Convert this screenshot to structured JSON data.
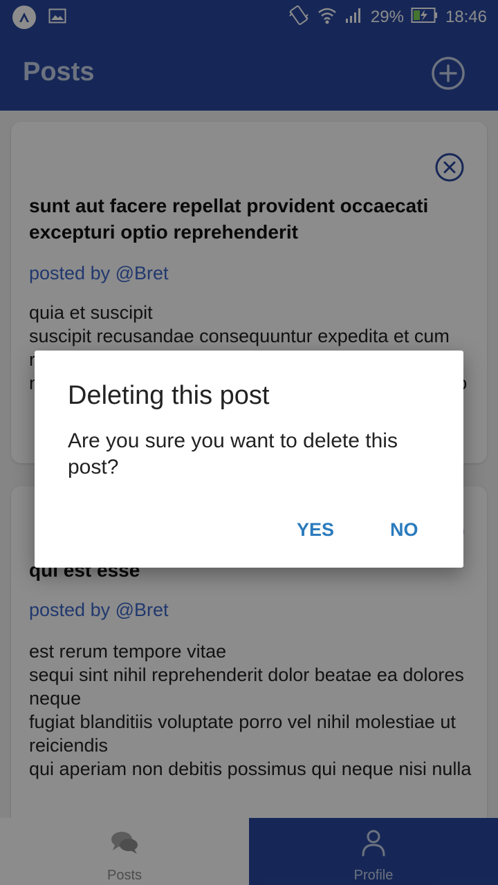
{
  "status_bar": {
    "app_icon": "expo-logo-icon",
    "image_icon": "image-icon",
    "vibrate_icon": "vibrate-icon",
    "wifi_icon": "wifi-icon",
    "signal_icon": "signal-icon",
    "battery_percent": "29%",
    "battery_icon": "battery-charging-icon",
    "time": "18:46"
  },
  "header": {
    "title": "Posts",
    "add_icon": "plus-circle-icon"
  },
  "posts": [
    {
      "title": "sunt aut facere repellat provident occaecati excepturi optio reprehenderit",
      "author": "posted by @Bret",
      "body": "quia et suscipit\nsuscipit recusandae consequuntur expedita et cum\nreprehenderit molestiae ut ut quas totam\nnostrum rerum est autem sunt rem eveniet architecto",
      "delete_icon": "close-circle-icon"
    },
    {
      "title": "qui est esse",
      "author": "posted by @Bret",
      "body": "est rerum tempore vitae\nsequi sint nihil reprehenderit dolor beatae ea dolores neque\nfugiat blanditiis voluptate porro vel nihil molestiae ut reiciendis\nqui aperiam non debitis possimus qui neque nisi nulla",
      "delete_icon": "close-circle-icon"
    }
  ],
  "bottom_nav": {
    "posts_label": "Posts",
    "posts_icon": "comments-icon",
    "profile_label": "Profile",
    "profile_icon": "user-icon"
  },
  "dialog": {
    "title": "Deleting this post",
    "message": "Are you sure you want to delete this post?",
    "yes_label": "YES",
    "no_label": "NO"
  },
  "colors": {
    "primary": "#28489f",
    "accent_link": "#3c66c8",
    "dialog_button": "#2b7bbd"
  }
}
